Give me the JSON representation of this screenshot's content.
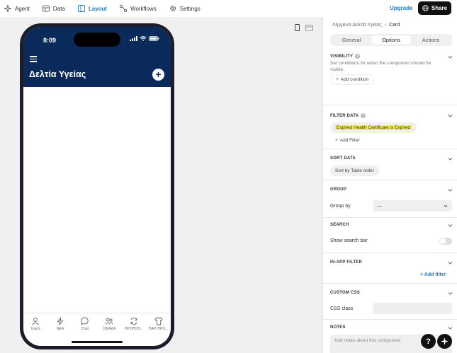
{
  "nav": {
    "items": [
      {
        "label": "Agent",
        "icon": "sparkle-icon"
      },
      {
        "label": "Data",
        "icon": "table-icon"
      },
      {
        "label": "Layout",
        "icon": "layout-icon"
      },
      {
        "label": "Workflows",
        "icon": "workflow-icon"
      },
      {
        "label": "Settings",
        "icon": "gear-icon"
      }
    ],
    "upgrade": "Upgrade",
    "share": "Share"
  },
  "phone": {
    "time": "8:09",
    "title": "Δελτία Υγείας",
    "tabs": [
      {
        "label": "Users",
        "icon": "user-icon"
      },
      {
        "label": "ΝΕΑ",
        "icon": "bolt-icon"
      },
      {
        "label": "Chat",
        "icon": "chat-icon"
      },
      {
        "label": "ΟΜΑΔΑ",
        "icon": "group-icon"
      },
      {
        "label": "ΠΡΟΠΟΝ...",
        "icon": "refresh-icon"
      },
      {
        "label": "ΠΑΡ. ΠΡΟ...",
        "icon": "shirt-icon"
      }
    ]
  },
  "panel": {
    "breadcrumb": {
      "parent": "Ληγμενα Δελτία Υγείας",
      "current": "Card"
    },
    "tabs": [
      "General",
      "Options",
      "Actions"
    ],
    "active_tab": "Options",
    "visibility": {
      "title": "VISIBILITY",
      "desc": "Set conditions for when the component should be visible.",
      "button": "Add condition"
    },
    "filter_data": {
      "title": "FILTER DATA",
      "filter": "Expired Health Certificate is Expired",
      "button": "Add Filter"
    },
    "sort_data": {
      "title": "SORT DATA",
      "chip": "Sort by Table order"
    },
    "group": {
      "title": "GROUP",
      "label": "Group by",
      "value": "—"
    },
    "search": {
      "title": "SEARCH",
      "label": "Show search bar",
      "enabled": false
    },
    "in_app_filter": {
      "title": "IN-APP FILTER",
      "button": "Add filter"
    },
    "custom_css": {
      "title": "CUSTOM CSS",
      "label": "CSS class"
    },
    "notes": {
      "title": "NOTES",
      "placeholder": "Add notes about this component"
    }
  },
  "help": "?",
  "colors": {
    "accent": "#1d7ed1",
    "phone_header": "#0b2a5c",
    "highlight": "#f3f055"
  }
}
